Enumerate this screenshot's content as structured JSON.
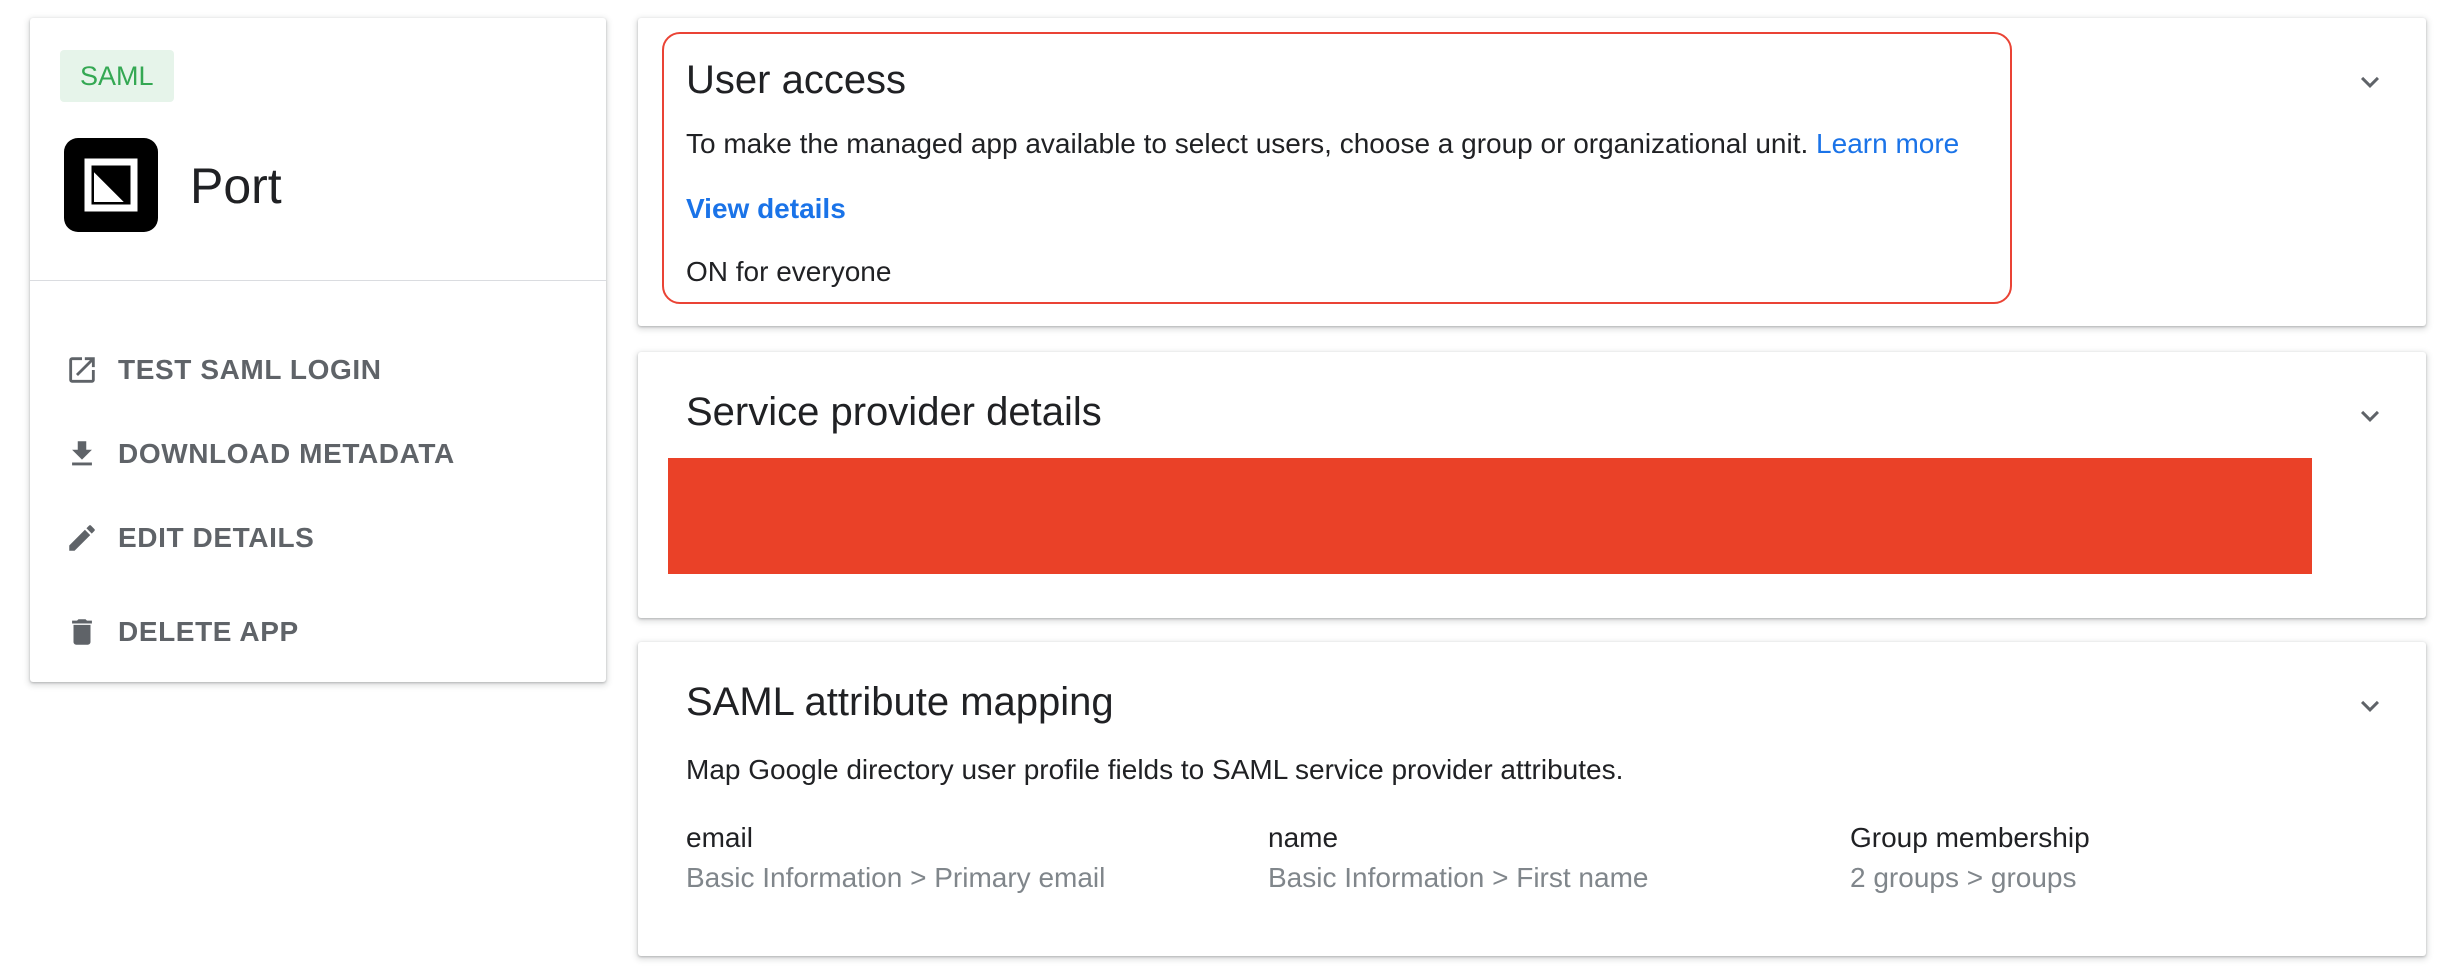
{
  "app": {
    "badge": "SAML",
    "name": "Port",
    "logo_icon": "port-logo-icon"
  },
  "actions": [
    {
      "label": "TEST SAML LOGIN",
      "icon": "open-in-new-icon"
    },
    {
      "label": "DOWNLOAD METADATA",
      "icon": "download-icon"
    },
    {
      "label": "EDIT DETAILS",
      "icon": "pencil-icon"
    },
    {
      "label": "DELETE APP",
      "icon": "trash-icon"
    }
  ],
  "user_access": {
    "title": "User access",
    "description": "To make the managed app available to select users, choose a group or organizational unit.",
    "learn_more": "Learn more",
    "view_details": "View details",
    "status": "ON for everyone"
  },
  "service_provider": {
    "title": "Service provider details"
  },
  "saml_mapping": {
    "title": "SAML attribute mapping",
    "description": "Map Google directory user profile fields to SAML service provider attributes.",
    "mappings": [
      {
        "key": "email",
        "value": "Basic Information > Primary email"
      },
      {
        "key": "name",
        "value": "Basic Information > First name"
      },
      {
        "key": "Group membership",
        "value": "2 groups > groups"
      }
    ]
  },
  "colors": {
    "accent_link": "#1a73e8",
    "highlight_border": "#ea4335",
    "redaction": "#ea4128",
    "badge_bg": "#e6f4ea",
    "badge_text": "#34a853"
  }
}
